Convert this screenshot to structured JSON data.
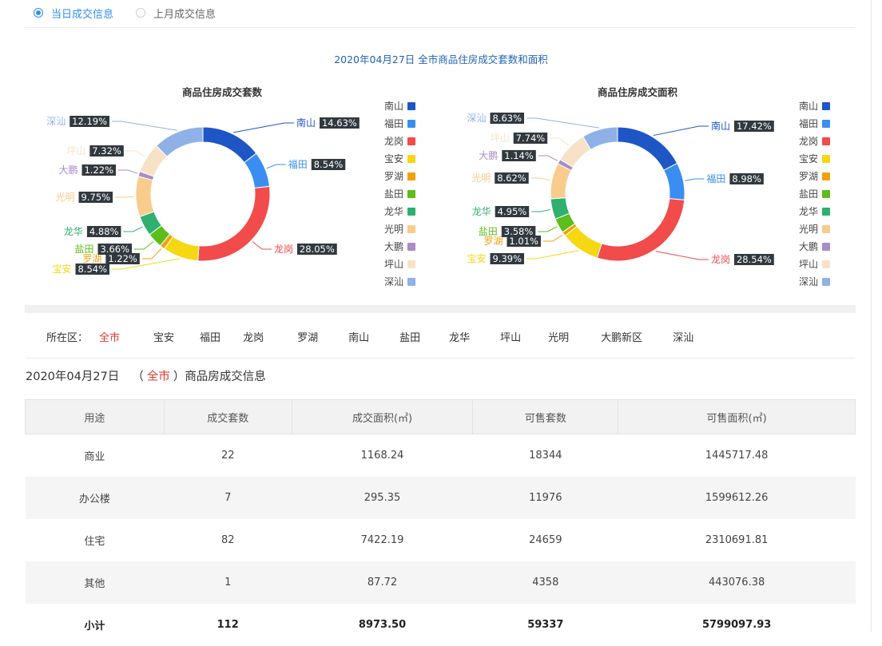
{
  "tabs": [
    {
      "label": "当日成交信息",
      "active": true
    },
    {
      "label": "上月成交信息",
      "active": false
    }
  ],
  "chart_header": "2020年04月27日 全市商品住房成交套数和面积",
  "chart_data": [
    {
      "type": "pie",
      "title": "商品住房成交套数",
      "labels": [
        "南山",
        "福田",
        "龙岗",
        "宝安",
        "罗湖",
        "盐田",
        "龙华",
        "光明",
        "大鹏",
        "坪山",
        "深汕"
      ],
      "values": [
        14.63,
        8.54,
        28.05,
        8.54,
        1.22,
        3.66,
        4.88,
        9.75,
        1.22,
        7.32,
        12.19
      ],
      "legend_position": "right"
    },
    {
      "type": "pie",
      "title": "商品住房成交面积",
      "labels": [
        "南山",
        "福田",
        "龙岗",
        "宝安",
        "罗湖",
        "盐田",
        "龙华",
        "光明",
        "大鹏",
        "坪山",
        "深汕"
      ],
      "values": [
        17.42,
        8.98,
        28.54,
        9.39,
        1.01,
        3.58,
        4.95,
        8.62,
        1.14,
        7.74,
        8.63
      ],
      "legend_position": "right"
    }
  ],
  "series_colors": [
    "#1e56c6",
    "#3a8ef2",
    "#f24b4b",
    "#f5d712",
    "#f0a10c",
    "#5cbd1b",
    "#2fb06e",
    "#f7cc8d",
    "#a98dc5",
    "#f7e2c8",
    "#8fb1e8"
  ],
  "legend": [
    "南山",
    "福田",
    "龙岗",
    "宝安",
    "罗湖",
    "盐田",
    "龙华",
    "光明",
    "大鹏",
    "坪山",
    "深汕"
  ],
  "district_filter": {
    "label": "所在区：",
    "options": [
      "全市",
      "宝安",
      "福田",
      "龙岗",
      "罗湖",
      "南山",
      "盐田",
      "龙华",
      "坪山",
      "光明",
      "大鹏新区",
      "深汕"
    ],
    "selected": "全市"
  },
  "table_title": {
    "date": "2020年04月27日",
    "open_paren": "（",
    "city": "全市",
    "close_paren": "）",
    "suffix": "商品房成交信息"
  },
  "table": {
    "headers": [
      "用途",
      "成交套数",
      "成交面积(㎡)",
      "可售套数",
      "可售面积(㎡)"
    ],
    "rows": [
      [
        "商业",
        "22",
        "1168.24",
        "18344",
        "1445717.48"
      ],
      [
        "办公楼",
        "7",
        "295.35",
        "11976",
        "1599612.26"
      ],
      [
        "住宅",
        "82",
        "7422.19",
        "24659",
        "2310691.81"
      ],
      [
        "其他",
        "1",
        "87.72",
        "4358",
        "443076.38"
      ],
      [
        "小计",
        "112",
        "8973.50",
        "59337",
        "5799097.93"
      ]
    ]
  }
}
